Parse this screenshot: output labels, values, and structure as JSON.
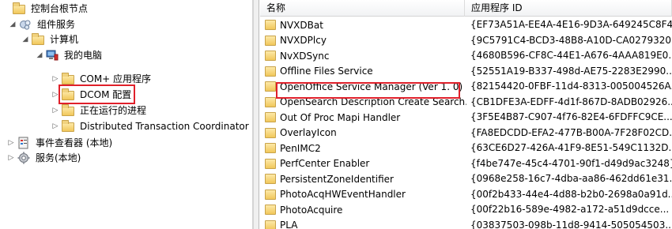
{
  "tree": {
    "items": [
      {
        "label": "控制台根节点",
        "expander": "",
        "icon": "folder-icon"
      },
      {
        "label": "组件服务",
        "expander": "◢",
        "icon": "component-services-icon"
      },
      {
        "label": "计算机",
        "expander": "◢",
        "icon": "folder-icon"
      },
      {
        "label": "我的电脑",
        "expander": "◢",
        "icon": "computer-icon"
      },
      {
        "label": "COM+ 应用程序",
        "expander": "▷",
        "icon": "folder-icon"
      },
      {
        "label": "DCOM 配置",
        "expander": "▷",
        "icon": "folder-icon"
      },
      {
        "label": "正在运行的进程",
        "expander": "▷",
        "icon": "folder-icon"
      },
      {
        "label": "Distributed Transaction Coordinator",
        "expander": "▷",
        "icon": "folder-icon"
      },
      {
        "label": "事件查看器 (本地)",
        "expander": "▷",
        "icon": "event-viewer-icon"
      },
      {
        "label": "服务(本地)",
        "expander": "▷",
        "icon": "gear-services-icon"
      }
    ]
  },
  "list": {
    "columns": {
      "name": "名称",
      "app_id": "应用程序 ID"
    },
    "rows": [
      {
        "name": "NVXDBat",
        "app_id": "{EF73A51A-EE4A-4E16-9D3A-649245C8F4..."
      },
      {
        "name": "NVXDPlcy",
        "app_id": "{9C5791C4-BCD3-48B8-A10D-CA0279320..."
      },
      {
        "name": "NvXDSync",
        "app_id": "{4680B596-CF8C-44E1-A676-4AAA819E0..."
      },
      {
        "name": "Offline Files Service",
        "app_id": "{52551A19-B337-498d-AE75-2283E2990..."
      },
      {
        "name": "OpenOffice Service Manager (Ver 1. 0)",
        "app_id": "{82154420-0FBF-11d4-8313-005004526A..."
      },
      {
        "name": "OpenSearch Description Create Search...",
        "app_id": "{CB1DFE3A-EDFF-4d1f-867D-8ADB02926..."
      },
      {
        "name": "Out Of Proc Mapi Handler",
        "app_id": "{3F5E4B87-C907-4f76-82E4-6FDFFC9CE..."
      },
      {
        "name": "OverlayIcon",
        "app_id": "{FA8EDCDD-EFA2-477B-B00A-7F28F02CD..."
      },
      {
        "name": "PenIMC2",
        "app_id": "{63CE6D27-426A-41F9-8E51-549C1132D..."
      },
      {
        "name": "PerfCenter Enabler",
        "app_id": "{f4be747e-45c4-4701-90f1-d49d9ac3248}"
      },
      {
        "name": "PersistentZoneIdentifier",
        "app_id": "{0968e258-16c7-4dba-aa86-462dd61e31..."
      },
      {
        "name": "PhotoAcqHWEventHandler",
        "app_id": "{00f2b433-44e4-4d88-b2b0-2698a0a91d..."
      },
      {
        "name": "PhotoAcquire",
        "app_id": "{00f22b16-589e-4982-a172-a51d9dcce..."
      },
      {
        "name": "PLA",
        "app_id": "{03837503-098b-11d8-9414-505054503..."
      }
    ]
  }
}
